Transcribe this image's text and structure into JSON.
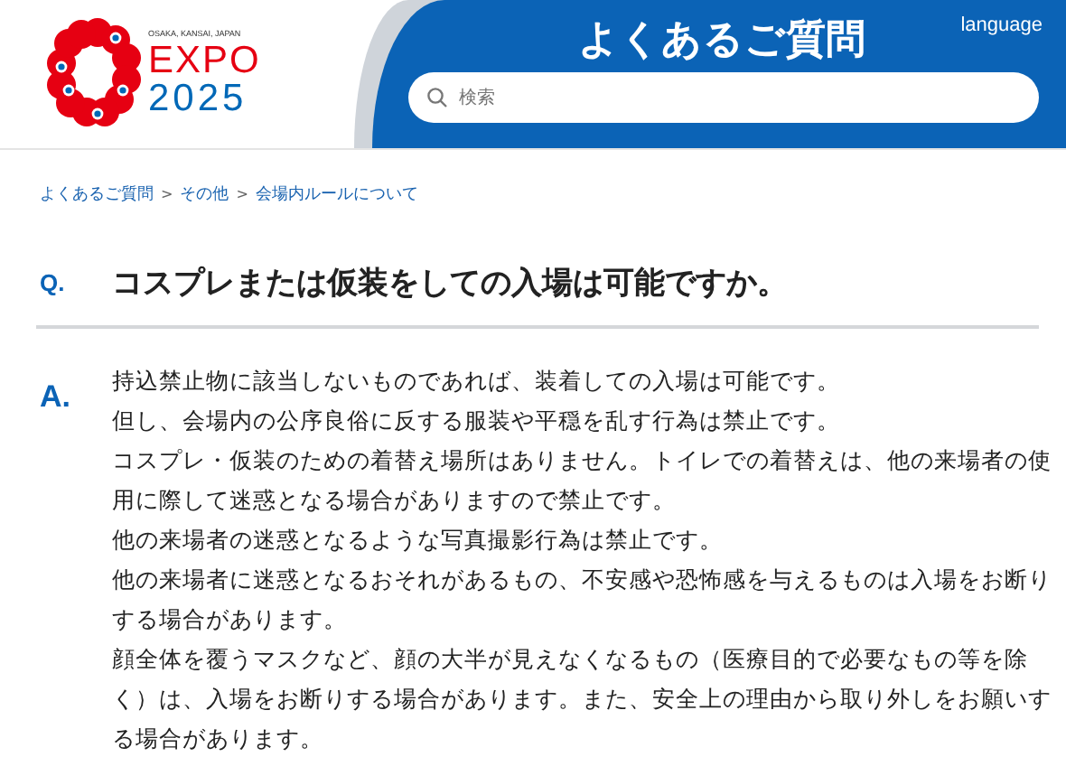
{
  "logo": {
    "tagline": "OSAKA, KANSAI, JAPAN",
    "word": "EXPO",
    "year": "2025"
  },
  "header": {
    "title": "よくあるご質問",
    "language": "language",
    "search": {
      "placeholder": "検索"
    }
  },
  "breadcrumb": {
    "separator": ">",
    "items": [
      "よくあるご質問",
      "その他",
      "会場内ルールについて"
    ]
  },
  "question": {
    "mark": "Q.",
    "text": "コスプレまたは仮装をしての入場は可能ですか。"
  },
  "answer": {
    "mark": "A.",
    "paragraphs": [
      "持込禁止物に該当しないものであれば、装着しての入場は可能です。",
      "但し、会場内の公序良俗に反する服装や平穏を乱す行為は禁止です。",
      "コスプレ・仮装のための着替え場所はありません。トイレでの着替えは、他の来場者の使用に際して迷惑となる場合がありますので禁止です。",
      "他の来場者の迷惑となるような写真撮影行為は禁止です。",
      "他の来場者に迷惑となるおそれがあるもの、不安感や恐怖感を与えるものは入場をお断りする場合があります。",
      "顔全体を覆うマスクなど、顔の大半が見えなくなるもの（医療目的で必要なもの等を除く）は、入場をお断りする場合があります。また、安全上の理由から取り外しをお願いする場合があります。"
    ]
  }
}
